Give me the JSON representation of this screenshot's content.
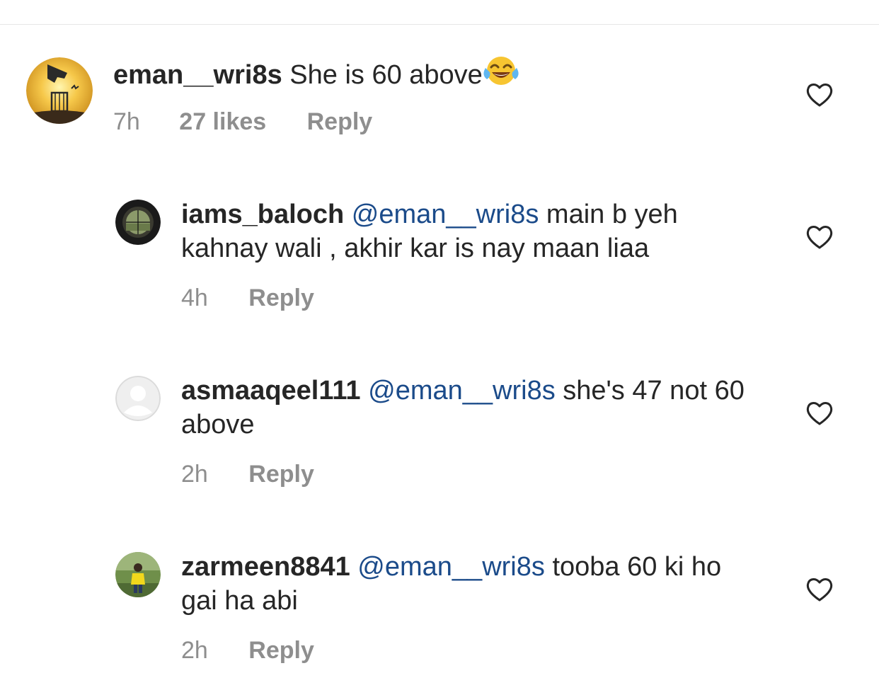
{
  "comments": [
    {
      "username": "eman__wri8s",
      "mention": "",
      "text": "She is 60 above",
      "emoji": "laughing-crying-emoji",
      "time": "7h",
      "likes": "27 likes",
      "reply_label": "Reply"
    },
    {
      "username": "iams_baloch",
      "mention": "@eman__wri8s",
      "text": "main b yeh kahnay wali , akhir kar is nay maan liaa",
      "time": "4h",
      "reply_label": "Reply"
    },
    {
      "username": "asmaaqeel111",
      "mention": "@eman__wri8s",
      "text": "she's 47 not 60 above",
      "time": "2h",
      "reply_label": "Reply"
    },
    {
      "username": "zarmeen8841",
      "mention": "@eman__wri8s",
      "text": "tooba 60 ki ho gai ha abi",
      "time": "2h",
      "reply_label": "Reply"
    }
  ],
  "icons": {
    "like": "heart-outline-icon"
  },
  "colors": {
    "text": "#262626",
    "meta": "#8e8e8e",
    "mention": "#1b4b8a"
  }
}
